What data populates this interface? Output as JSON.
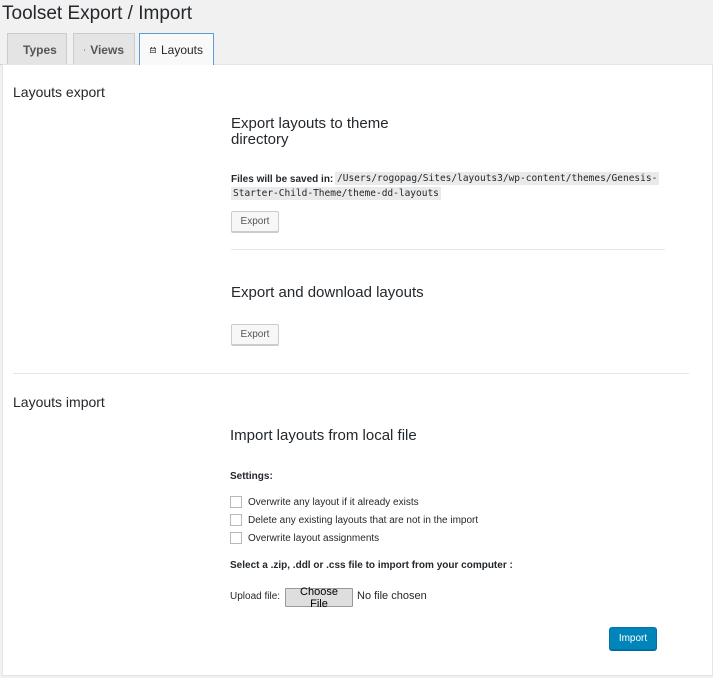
{
  "page": {
    "title": "Toolset Export / Import"
  },
  "tabs": [
    {
      "label": "Types",
      "icon": "toolset-icon",
      "active": false
    },
    {
      "label": "Views",
      "icon": "toolset-icon",
      "active": false
    },
    {
      "label": "Layouts",
      "icon": "layouts-icon",
      "active": true
    }
  ],
  "export": {
    "section_title": "Layouts export",
    "theme_dir": {
      "title_line1": "Export layouts to theme",
      "title_line2": "directory",
      "files_saved_label": "Files will be saved in:",
      "path_line1": "/Users/rogopag/Sites/layouts3/wp-content/themes/Genesis-",
      "path_line2": "Starter-Child-Theme/theme-dd-layouts",
      "button": "Export"
    },
    "download": {
      "title": "Export and download layouts",
      "button": "Export"
    }
  },
  "import": {
    "section_title": "Layouts import",
    "title": "Import layouts from local file",
    "settings_label": "Settings:",
    "options": [
      {
        "label": "Overwrite any layout if it already exists",
        "checked": false
      },
      {
        "label": "Delete any existing layouts that are not in the import",
        "checked": false
      },
      {
        "label": "Overwrite layout assignments",
        "checked": false
      }
    ],
    "select_label": "Select a .zip, .ddl or .css file to import from your computer :",
    "upload_label": "Upload file:",
    "choose_file_button": "Choose File",
    "no_file_text": "No file chosen",
    "import_button": "Import"
  },
  "colors": {
    "primary": "#0085ba",
    "active_tab_border": "#5b9dd9"
  }
}
